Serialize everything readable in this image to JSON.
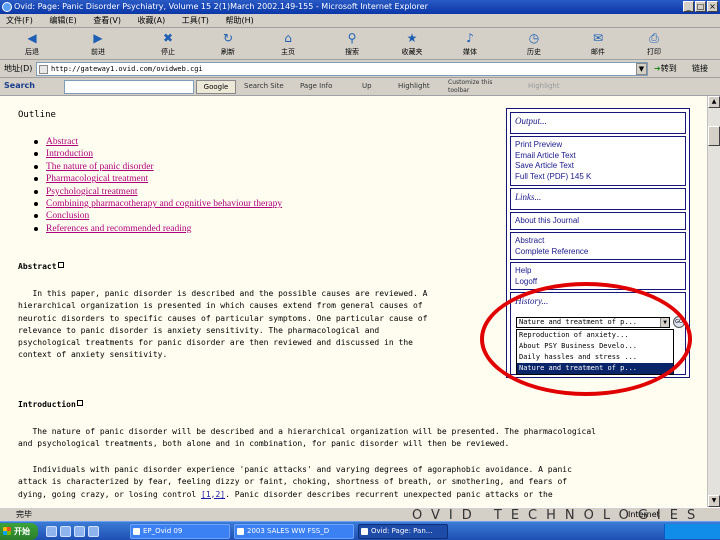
{
  "window": {
    "title": "Ovid: Page: Panic Disorder Psychiatry, Volume 15 2(1)March 2002.149-155 - Microsoft Internet Explorer"
  },
  "menu": [
    "文件(F)",
    "编辑(E)",
    "查看(V)",
    "收藏(A)",
    "工具(T)",
    "帮助(H)"
  ],
  "toolbar": {
    "buttons": [
      {
        "label": "后退",
        "icon": "back-arrow-icon"
      },
      {
        "label": "前进",
        "icon": "forward-arrow-icon"
      },
      {
        "label": "停止",
        "icon": "stop-icon"
      },
      {
        "label": "刷新",
        "icon": "refresh-icon"
      },
      {
        "label": "主页",
        "icon": "home-icon"
      },
      {
        "label": "搜索",
        "icon": "search-icon"
      },
      {
        "label": "收藏夹",
        "icon": "favorites-icon"
      },
      {
        "label": "媒体",
        "icon": "media-icon"
      },
      {
        "label": "历史",
        "icon": "history-icon"
      },
      {
        "label": "邮件",
        "icon": "mail-icon"
      },
      {
        "label": "打印",
        "icon": "print-icon"
      }
    ]
  },
  "address": {
    "label": "地址(D)",
    "url": "http://gateway1.ovid.com/ovidweb.cgi",
    "go_label": "转到",
    "links_label": "链接"
  },
  "google_bar": {
    "logo": "Search",
    "button": "Google",
    "items": [
      "Search Site",
      "Page Info",
      "Up",
      "Highlight",
      "Customize this toolbar",
      "Highlight"
    ]
  },
  "page": {
    "outline_title": "Outline",
    "outline_items": [
      "Abstract",
      "Introduction",
      "The nature of panic disorder",
      "Pharmacological treatment",
      "Psychological treatment",
      "Combining pharmacotherapy and cognitive behaviour therapy",
      "Conclusion",
      "References and recommended reading"
    ],
    "abstract_title": "Abstract",
    "abstract_text": "   In this paper, panic disorder is described and the possible causes are reviewed. A\nhierarchical organization is presented in which causes extend from general causes of\nneurotic disorders to specific causes of particular symptoms. One particular cause of\nrelevance to panic disorder is anxiety sensitivity. The pharmacological and\npsychological treatments for panic disorder are then reviewed and discussed in the\ncontext of anxiety sensitivity.",
    "intro_title": "Introduction",
    "intro_p1": "   The nature of panic disorder will be described and a hierarchical organization will be presented. The pharmacological\nand psychological treatments, both alone and in combination, for panic disorder will then be reviewed.",
    "intro_p2_lines": [
      "   Individuals with panic disorder experience 'panic attacks' and varying degrees of agoraphobic avoidance. A panic",
      "attack is characterized by fear, feeling dizzy or faint, choking, shortness of breath, or smothering, and fears of",
      "dying, going crazy, or losing control "
    ],
    "intro_ref": "[1,2]",
    "intro_p2_tail": ". Panic disorder describes recurrent unexpected panic attacks or the"
  },
  "sidebar": {
    "output_title": "Output...",
    "output_items": [
      "Print Preview",
      "Email Article Text",
      "Save Article Text",
      "Full Text (PDF) 145 K"
    ],
    "links_title": "Links...",
    "links_items": [
      "About this Journal"
    ],
    "ref_items": [
      "Abstract",
      "Complete Reference"
    ],
    "help_items": [
      "Help",
      "Logoff"
    ],
    "history_title": "History...",
    "history_selected": "Nature and treatment of p...",
    "history_go": "GO",
    "history_options": [
      "Reproduction of anxiety...",
      "About PSY Business Develo...",
      "Daily hassles and stress ...",
      "Nature and treatment of p..."
    ]
  },
  "footer": {
    "watermark": "OVID TECHNOLOGIES",
    "status": "完毕",
    "zone": "Internet"
  },
  "taskbar": {
    "start": "开始",
    "tasks": [
      "EP_Ovid 09",
      "2003 SALES WW FSS_D",
      "Ovid: Page: Pan..."
    ]
  }
}
